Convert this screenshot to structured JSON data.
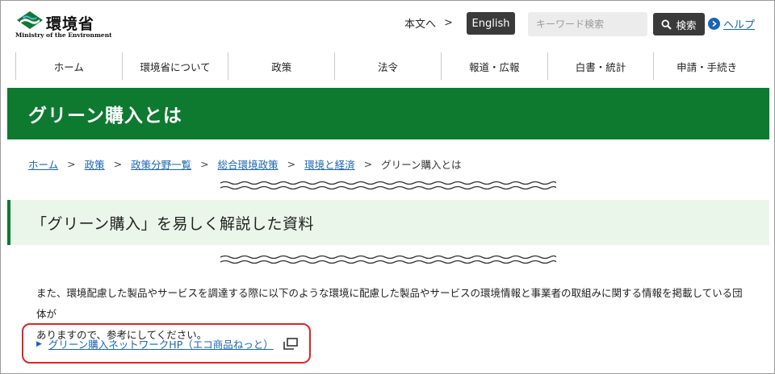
{
  "header": {
    "logo_title": "環境省",
    "logo_subtitle": "Ministry of the Environment",
    "skip_link": "本文へ",
    "english_label": "English",
    "search_placeholder": "キーワード検索",
    "search_button": "検索",
    "help_link": "ヘルプ"
  },
  "nav": {
    "items": [
      "ホーム",
      "環境省について",
      "政策",
      "法令",
      "報道・広報",
      "白書・統計",
      "申請・手続き"
    ]
  },
  "page": {
    "title": "グリーン購入とは"
  },
  "breadcrumb": {
    "links": [
      "ホーム",
      "政策",
      "政策分野一覧",
      "総合環境政策",
      "環境と経済"
    ],
    "separator": ">",
    "current": "グリーン購入とは"
  },
  "section": {
    "heading": "「グリーン購入」を易しく解説した資料"
  },
  "body": {
    "line1": "また、環境配慮した製品やサービスを調達する際に以下のような環境に配慮した製品やサービスの環境情報と事業者の取組みに関する情報を掲載している団体が",
    "line2": "ありますので、参考にしてください。"
  },
  "external_link": {
    "label": "グリーン購入ネットワークHP（エコ商品ねっと）"
  },
  "colors": {
    "brand_green": "#0d7a2f",
    "light_green": "#eaf6ea",
    "link_blue": "#1a64b4",
    "highlight_red": "#d9262a",
    "dark_button": "#3a3a3a"
  }
}
